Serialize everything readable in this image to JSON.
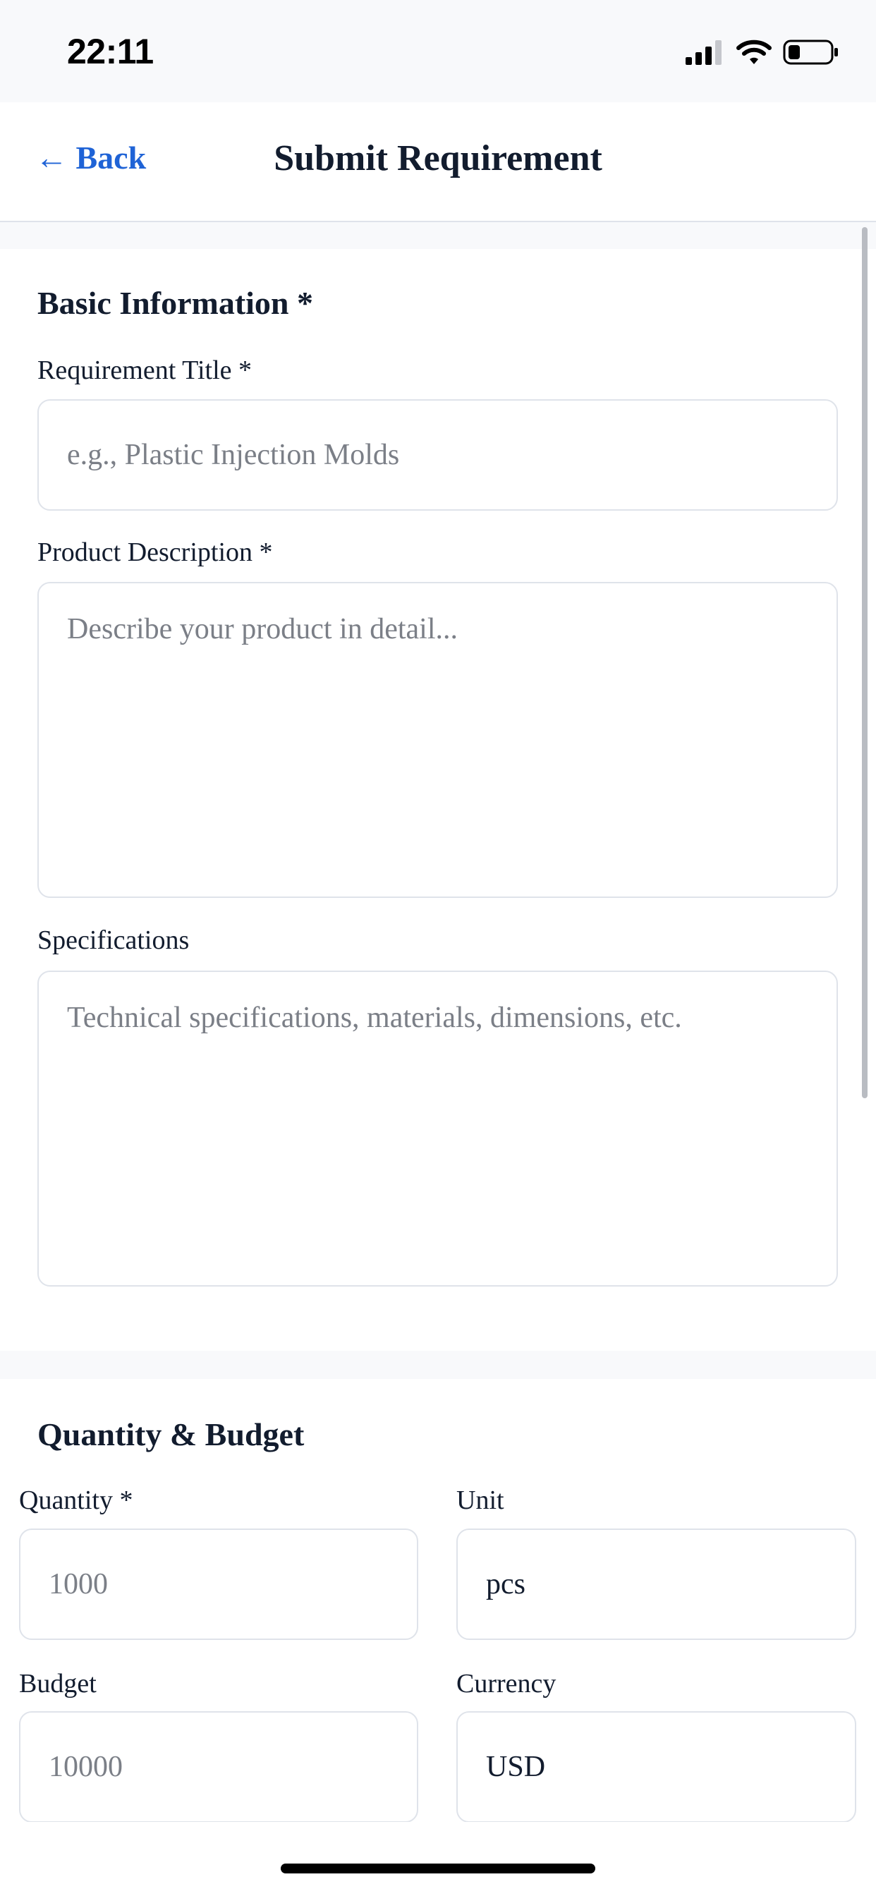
{
  "status_bar": {
    "time": "22:11",
    "icons": [
      "cellular-signal-icon",
      "wifi-icon",
      "battery-icon"
    ]
  },
  "header": {
    "back_label": "← Back",
    "title": "Submit Requirement"
  },
  "basic_info": {
    "title": "Basic Information *",
    "requirement_title": {
      "label": "Requirement Title *",
      "value": "",
      "placeholder": "e.g., Plastic Injection Molds"
    },
    "product_description": {
      "label": "Product Description *",
      "value": "",
      "placeholder": "Describe your product in detail..."
    },
    "specifications": {
      "label": "Specifications",
      "value": "",
      "placeholder": "Technical specifications, materials, dimensions, etc."
    }
  },
  "quantity_budget": {
    "title": "Quantity & Budget",
    "quantity": {
      "label": "Quantity *",
      "value": "",
      "placeholder": "1000"
    },
    "unit": {
      "label": "Unit",
      "value": "pcs"
    },
    "budget": {
      "label": "Budget",
      "value": "",
      "placeholder": "10000"
    },
    "currency": {
      "label": "Currency",
      "value": "USD"
    }
  },
  "colors": {
    "accent": "#1f63d6",
    "text": "#121c2e",
    "placeholder": "#7b7f87",
    "border": "#dfe3ea",
    "background": "#f8f9fb"
  }
}
